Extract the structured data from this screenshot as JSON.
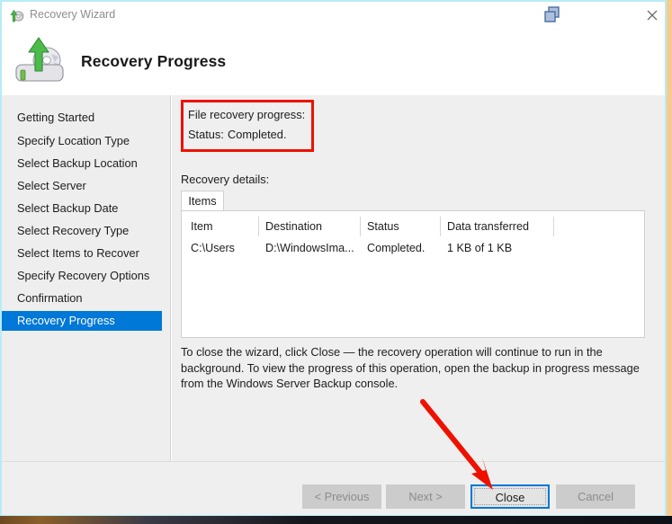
{
  "window": {
    "title": "Recovery Wizard",
    "title_icon": "recovery-wizard-icon",
    "restore_icon": "restore-window-icon",
    "close_icon": "close-window-icon"
  },
  "header": {
    "title": "Recovery Progress",
    "icon": "recovery-drive-icon"
  },
  "sidebar": {
    "items": [
      {
        "label": "Getting Started",
        "selected": false
      },
      {
        "label": "Specify Location Type",
        "selected": false
      },
      {
        "label": "Select Backup Location",
        "selected": false
      },
      {
        "label": "Select Server",
        "selected": false
      },
      {
        "label": "Select Backup Date",
        "selected": false
      },
      {
        "label": "Select Recovery Type",
        "selected": false
      },
      {
        "label": "Select Items to Recover",
        "selected": false
      },
      {
        "label": "Specify Recovery Options",
        "selected": false
      },
      {
        "label": "Confirmation",
        "selected": false
      },
      {
        "label": "Recovery Progress",
        "selected": true
      }
    ],
    "selected_color": "#0078d7"
  },
  "main": {
    "progress_label": "File recovery progress:",
    "status_label": "Status:",
    "status_value": "Completed.",
    "highlight_color": "#ee1100",
    "details_label": "Recovery details:",
    "tab_label": "Items",
    "table": {
      "columns": [
        "Item",
        "Destination",
        "Status",
        "Data transferred"
      ],
      "rows": [
        [
          "C:\\Users",
          "D:\\WindowsIma...",
          "Completed.",
          "1 KB of 1 KB"
        ]
      ]
    },
    "note_line1": "To close the wizard, click Close — the recovery operation will continue to run in the background.",
    "note_line2": "To view the progress of this operation, open the backup in progress message from the Windows Server Backup console."
  },
  "buttons": {
    "previous": "< Previous",
    "next": "Next >",
    "close": "Close",
    "cancel": "Cancel",
    "focus_color": "#0078d7"
  },
  "annotation": {
    "arrow_color": "#ee1100",
    "arrow_target": "close-button"
  }
}
